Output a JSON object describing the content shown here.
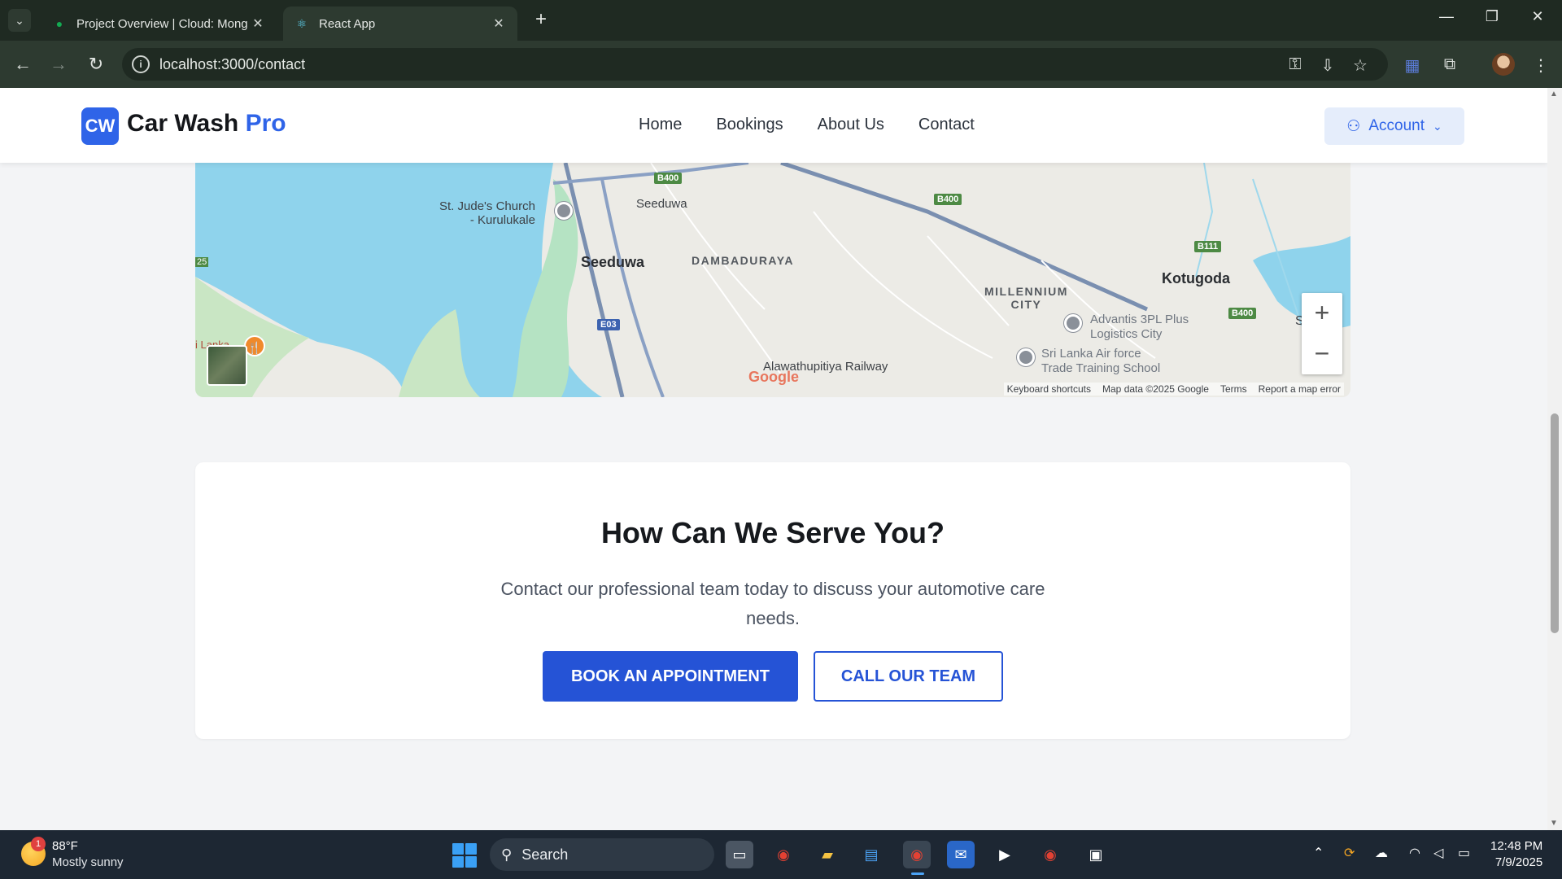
{
  "browser": {
    "tabs": [
      {
        "title": "Project Overview | Cloud: Mong",
        "active": false
      },
      {
        "title": "React App",
        "active": true
      }
    ],
    "url": "localhost:3000/contact",
    "close_glyph": "✕",
    "new_tab_glyph": "+"
  },
  "header": {
    "logo_badge": "CW",
    "logo_main": "Car Wash",
    "logo_accent": "Pro",
    "nav": [
      "Home",
      "Bookings",
      "About Us",
      "Contact"
    ],
    "account_label": "Account"
  },
  "map": {
    "labels": {
      "church": "St. Jude's Church\n- Kurulukale",
      "seeduwa_small": "Seeduwa",
      "seeduwa": "Seeduwa",
      "dambaduraya": "DAMBADURAYA",
      "millennium": "MILLENNIUM\nCITY",
      "kotugoda": "Kotugoda",
      "advantis": "Advantis 3PL Plus\nLogistics City",
      "airforce": "Sri Lanka Air force\nTrade Training School",
      "railway": "Alawathupitiya Railway",
      "lanka": "i Lanka",
      "edge_b": "S      b",
      "edge_25": "25"
    },
    "road_tags": [
      "B400",
      "B400",
      "B111",
      "B400",
      "E03"
    ],
    "google_logo": "Google",
    "footer": [
      "Keyboard shortcuts",
      "Map data ©2025 Google",
      "Terms",
      "Report a map error"
    ],
    "zoom_in": "+",
    "zoom_out": "−"
  },
  "cta": {
    "title": "How Can We Serve You?",
    "text": "Contact our professional team today to discuss your automotive care needs.",
    "primary_button": "BOOK AN APPOINTMENT",
    "secondary_button": "CALL OUR TEAM"
  },
  "taskbar": {
    "weather_badge": "1",
    "temperature": "88°F",
    "weather_desc": "Mostly sunny",
    "search_label": "Search",
    "time": "12:48 PM",
    "date": "7/9/2025"
  },
  "colors": {
    "brand": "#2f64e8",
    "button_primary": "#2553d6",
    "chrome_bg": "#1f2a22",
    "taskbar_bg": "#1d2733"
  }
}
